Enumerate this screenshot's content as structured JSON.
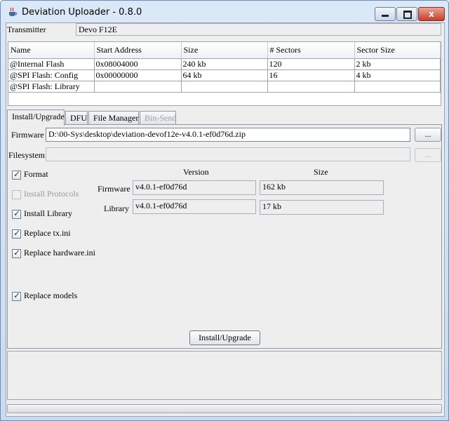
{
  "window": {
    "title": "Deviation Uploader - 0.8.0",
    "close_glyph": "x"
  },
  "transmitter": {
    "label": "Transmitter",
    "value": "Devo F12E"
  },
  "table": {
    "columns": [
      "Name",
      "Start Address",
      "Size",
      "# Sectors",
      "Sector Size"
    ],
    "rows": [
      [
        "@Internal Flash",
        "0x08004000",
        "240 kb",
        "120",
        "2 kb"
      ],
      [
        "@SPI Flash: Config",
        "0x00000000",
        "64 kb",
        "16",
        "4 kb"
      ],
      [
        "@SPI Flash: Library",
        "",
        "",
        "",
        ""
      ]
    ]
  },
  "tabs": [
    {
      "label": "Install/Upgrade",
      "active": true,
      "disabled": false
    },
    {
      "label": "DFU",
      "active": false,
      "disabled": false
    },
    {
      "label": "File Manager",
      "active": false,
      "disabled": false
    },
    {
      "label": "Bin-Send",
      "active": false,
      "disabled": true
    }
  ],
  "install": {
    "firmware_label": "Firmware",
    "firmware_path": "D:\\00-Sys\\desktop\\deviation-devof12e-v4.0.1-ef0d76d.zip",
    "filesystem_label": "Filesystem",
    "filesystem_path": "",
    "browse_label": "...",
    "version_header": "Version",
    "size_header": "Size",
    "info": [
      {
        "label": "Firmware",
        "version": "v4.0.1-ef0d76d",
        "size": "162 kb"
      },
      {
        "label": "Library",
        "version": "v4.0.1-ef0d76d",
        "size": "17 kb"
      }
    ],
    "options": [
      {
        "label": "Format",
        "checked": true,
        "disabled": false
      },
      {
        "label": "Install Protocols",
        "checked": false,
        "disabled": true
      },
      {
        "label": "Install Library",
        "checked": true,
        "disabled": false
      },
      {
        "label": "Replace tx.ini",
        "checked": true,
        "disabled": false
      },
      {
        "label": "Replace hardware.ini",
        "checked": true,
        "disabled": false
      },
      {
        "label": "Replace models",
        "checked": true,
        "disabled": false
      }
    ],
    "action_label": "Install/Upgrade"
  },
  "log": {
    "text": ""
  },
  "progress": {
    "fraction": 0
  },
  "colors": {
    "accent": "#5fa8e0"
  }
}
